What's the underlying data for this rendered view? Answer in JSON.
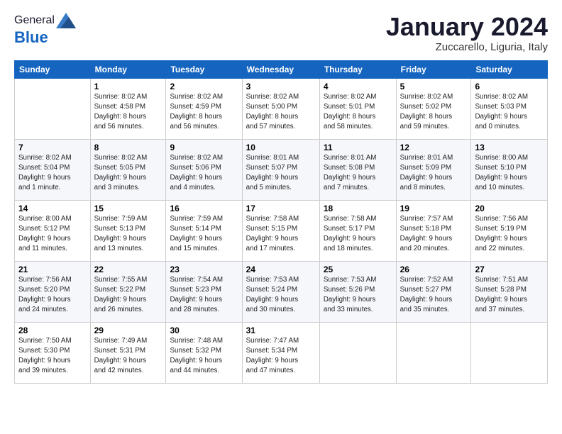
{
  "header": {
    "logo_general": "General",
    "logo_blue": "Blue",
    "month_title": "January 2024",
    "location": "Zuccarello, Liguria, Italy"
  },
  "days_of_week": [
    "Sunday",
    "Monday",
    "Tuesday",
    "Wednesday",
    "Thursday",
    "Friday",
    "Saturday"
  ],
  "weeks": [
    [
      {
        "day": "",
        "info": ""
      },
      {
        "day": "1",
        "info": "Sunrise: 8:02 AM\nSunset: 4:58 PM\nDaylight: 8 hours\nand 56 minutes."
      },
      {
        "day": "2",
        "info": "Sunrise: 8:02 AM\nSunset: 4:59 PM\nDaylight: 8 hours\nand 56 minutes."
      },
      {
        "day": "3",
        "info": "Sunrise: 8:02 AM\nSunset: 5:00 PM\nDaylight: 8 hours\nand 57 minutes."
      },
      {
        "day": "4",
        "info": "Sunrise: 8:02 AM\nSunset: 5:01 PM\nDaylight: 8 hours\nand 58 minutes."
      },
      {
        "day": "5",
        "info": "Sunrise: 8:02 AM\nSunset: 5:02 PM\nDaylight: 8 hours\nand 59 minutes."
      },
      {
        "day": "6",
        "info": "Sunrise: 8:02 AM\nSunset: 5:03 PM\nDaylight: 9 hours\nand 0 minutes."
      }
    ],
    [
      {
        "day": "7",
        "info": "Sunrise: 8:02 AM\nSunset: 5:04 PM\nDaylight: 9 hours\nand 1 minute."
      },
      {
        "day": "8",
        "info": "Sunrise: 8:02 AM\nSunset: 5:05 PM\nDaylight: 9 hours\nand 3 minutes."
      },
      {
        "day": "9",
        "info": "Sunrise: 8:02 AM\nSunset: 5:06 PM\nDaylight: 9 hours\nand 4 minutes."
      },
      {
        "day": "10",
        "info": "Sunrise: 8:01 AM\nSunset: 5:07 PM\nDaylight: 9 hours\nand 5 minutes."
      },
      {
        "day": "11",
        "info": "Sunrise: 8:01 AM\nSunset: 5:08 PM\nDaylight: 9 hours\nand 7 minutes."
      },
      {
        "day": "12",
        "info": "Sunrise: 8:01 AM\nSunset: 5:09 PM\nDaylight: 9 hours\nand 8 minutes."
      },
      {
        "day": "13",
        "info": "Sunrise: 8:00 AM\nSunset: 5:10 PM\nDaylight: 9 hours\nand 10 minutes."
      }
    ],
    [
      {
        "day": "14",
        "info": "Sunrise: 8:00 AM\nSunset: 5:12 PM\nDaylight: 9 hours\nand 11 minutes."
      },
      {
        "day": "15",
        "info": "Sunrise: 7:59 AM\nSunset: 5:13 PM\nDaylight: 9 hours\nand 13 minutes."
      },
      {
        "day": "16",
        "info": "Sunrise: 7:59 AM\nSunset: 5:14 PM\nDaylight: 9 hours\nand 15 minutes."
      },
      {
        "day": "17",
        "info": "Sunrise: 7:58 AM\nSunset: 5:15 PM\nDaylight: 9 hours\nand 17 minutes."
      },
      {
        "day": "18",
        "info": "Sunrise: 7:58 AM\nSunset: 5:17 PM\nDaylight: 9 hours\nand 18 minutes."
      },
      {
        "day": "19",
        "info": "Sunrise: 7:57 AM\nSunset: 5:18 PM\nDaylight: 9 hours\nand 20 minutes."
      },
      {
        "day": "20",
        "info": "Sunrise: 7:56 AM\nSunset: 5:19 PM\nDaylight: 9 hours\nand 22 minutes."
      }
    ],
    [
      {
        "day": "21",
        "info": "Sunrise: 7:56 AM\nSunset: 5:20 PM\nDaylight: 9 hours\nand 24 minutes."
      },
      {
        "day": "22",
        "info": "Sunrise: 7:55 AM\nSunset: 5:22 PM\nDaylight: 9 hours\nand 26 minutes."
      },
      {
        "day": "23",
        "info": "Sunrise: 7:54 AM\nSunset: 5:23 PM\nDaylight: 9 hours\nand 28 minutes."
      },
      {
        "day": "24",
        "info": "Sunrise: 7:53 AM\nSunset: 5:24 PM\nDaylight: 9 hours\nand 30 minutes."
      },
      {
        "day": "25",
        "info": "Sunrise: 7:53 AM\nSunset: 5:26 PM\nDaylight: 9 hours\nand 33 minutes."
      },
      {
        "day": "26",
        "info": "Sunrise: 7:52 AM\nSunset: 5:27 PM\nDaylight: 9 hours\nand 35 minutes."
      },
      {
        "day": "27",
        "info": "Sunrise: 7:51 AM\nSunset: 5:28 PM\nDaylight: 9 hours\nand 37 minutes."
      }
    ],
    [
      {
        "day": "28",
        "info": "Sunrise: 7:50 AM\nSunset: 5:30 PM\nDaylight: 9 hours\nand 39 minutes."
      },
      {
        "day": "29",
        "info": "Sunrise: 7:49 AM\nSunset: 5:31 PM\nDaylight: 9 hours\nand 42 minutes."
      },
      {
        "day": "30",
        "info": "Sunrise: 7:48 AM\nSunset: 5:32 PM\nDaylight: 9 hours\nand 44 minutes."
      },
      {
        "day": "31",
        "info": "Sunrise: 7:47 AM\nSunset: 5:34 PM\nDaylight: 9 hours\nand 47 minutes."
      },
      {
        "day": "",
        "info": ""
      },
      {
        "day": "",
        "info": ""
      },
      {
        "day": "",
        "info": ""
      }
    ]
  ]
}
